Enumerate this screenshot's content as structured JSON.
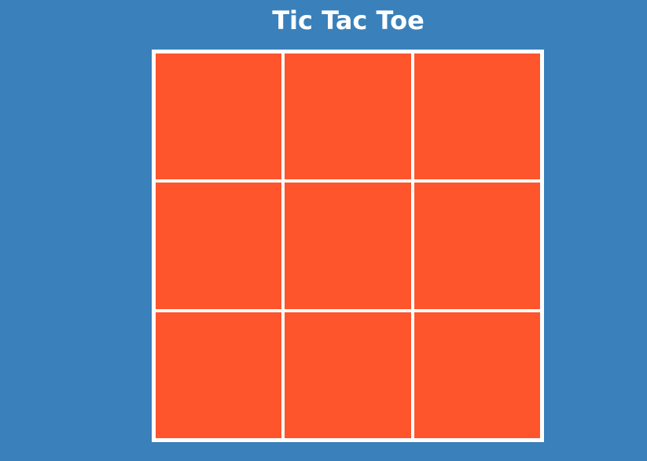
{
  "title": "Tic Tac Toe",
  "colors": {
    "background": "#3a80ba",
    "board_border": "#ffffff",
    "cell": "#ff552d",
    "title_text": "#ffffff"
  },
  "board": {
    "cells": [
      "",
      "",
      "",
      "",
      "",
      "",
      "",
      "",
      ""
    ]
  }
}
